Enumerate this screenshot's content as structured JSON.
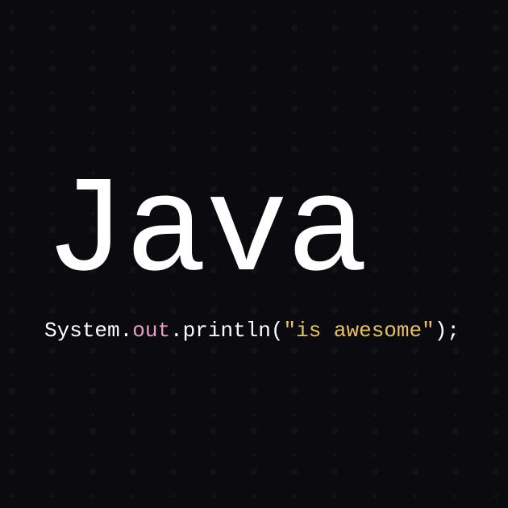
{
  "title": "Java",
  "code": {
    "part1": "System",
    "dot1": ".",
    "out": "out",
    "dot2": ".",
    "println": "println",
    "paren_open": "(",
    "string": "\"is awesome\"",
    "paren_close": ")",
    "semicolon": ";"
  }
}
